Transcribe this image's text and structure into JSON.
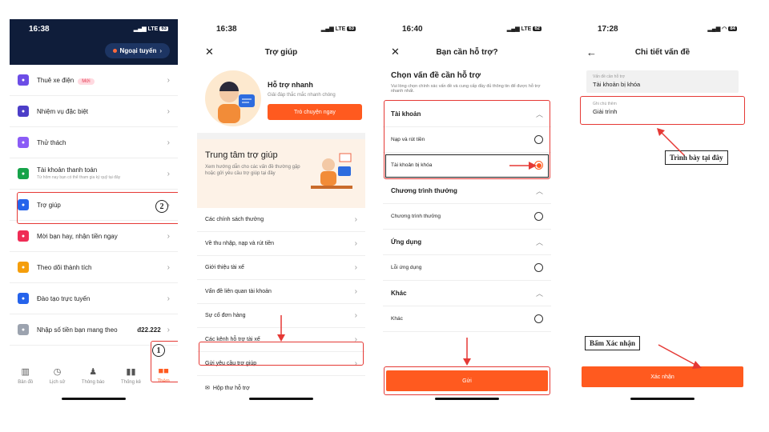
{
  "screen1": {
    "time": "16:38",
    "net": "LTE",
    "battery": "63",
    "offline": "Ngoại tuyến",
    "menu": [
      {
        "label": "Thuê xe điện",
        "tag": "Mới",
        "icon": "scooter-icon",
        "color": "#6c4de6"
      },
      {
        "label": "Nhiệm vụ đặc biệt",
        "icon": "flag-icon",
        "color": "#4c3ec8"
      },
      {
        "label": "Thử thách",
        "icon": "trophy-icon",
        "color": "#8b5cf6"
      },
      {
        "label": "Tài khoản thanh toán",
        "sub": "Từ hôm nay bạn có thể tham gia ký quỹ tại đây",
        "icon": "wallet-icon",
        "color": "#16a34a"
      },
      {
        "label": "Trợ giúp",
        "icon": "help-icon",
        "color": "#2563eb"
      },
      {
        "label": "Mời bạn hay, nhận tiền ngay",
        "icon": "heart-icon",
        "color": "#ef2d56"
      },
      {
        "label": "Theo dõi thành tích",
        "icon": "chart-icon",
        "color": "#f59e0b"
      },
      {
        "label": "Đào tạo trực tuyến",
        "icon": "book-icon",
        "color": "#2563eb"
      },
      {
        "label": "Nhập số tiền bạn mang theo",
        "value": "đ22.222",
        "icon": "cash-icon",
        "color": "#9ca3af"
      }
    ],
    "tabs": [
      "Bản đồ",
      "Lịch sử",
      "Thông báo",
      "Thống kê",
      "Thêm"
    ],
    "badge1": "1",
    "badge2": "2"
  },
  "screen2": {
    "time": "16:38",
    "net": "LTE",
    "battery": "63",
    "title": "Trợ giúp",
    "quick_title": "Hỗ trợ nhanh",
    "quick_sub": "Giải đáp thắc mắc nhanh chóng",
    "chat_btn": "Trò chuyện ngay",
    "center_title": "Trung tâm trợ giúp",
    "center_sub": "Xem hướng dẫn cho các vấn đề thường gặp hoặc gửi yêu cầu trợ giúp tại đây",
    "items": [
      "Các chính sách thưởng",
      "Về thu nhập, nạp và rút tiền",
      "Giới thiệu tài xế",
      "Vấn đề liên quan tài khoản",
      "Sự cố đơn hàng",
      "Các kênh hỗ trợ tài xế",
      "Gửi yêu cầu trợ giúp"
    ],
    "mailbox": "Hộp thư hỗ trợ"
  },
  "screen3": {
    "time": "16:40",
    "net": "LTE",
    "battery": "62",
    "title": "Bạn cần hỗ trợ?",
    "heading": "Chọn vấn đề cần hỗ trợ",
    "desc": "Vui lòng chọn chính xác vấn đề và cung cấp đầy đủ thông tin để được hỗ trợ nhanh nhất.",
    "sections": [
      {
        "name": "Tài khoản",
        "options": [
          "Nạp và rút tiền",
          "Tài khoản bị khóa"
        ]
      },
      {
        "name": "Chương trình thưởng",
        "options": [
          "Chương trình thưởng"
        ]
      },
      {
        "name": "Ứng dụng",
        "options": [
          "Lỗi ứng dụng"
        ]
      },
      {
        "name": "Khác",
        "options": [
          "Khác"
        ]
      }
    ],
    "send_btn": "Gửi"
  },
  "screen4": {
    "time": "17:28",
    "battery": "84",
    "title": "Chi tiết vấn đề",
    "issue_label": "Vấn đề cần hỗ trợ",
    "issue_value": "Tài khoản bị khóa",
    "note_label": "Ghi chú thêm",
    "note_value": "Giải trình",
    "note1": "Trình bày tại đây",
    "note2": "Bấm Xác nhận",
    "confirm_btn": "Xác nhận"
  }
}
